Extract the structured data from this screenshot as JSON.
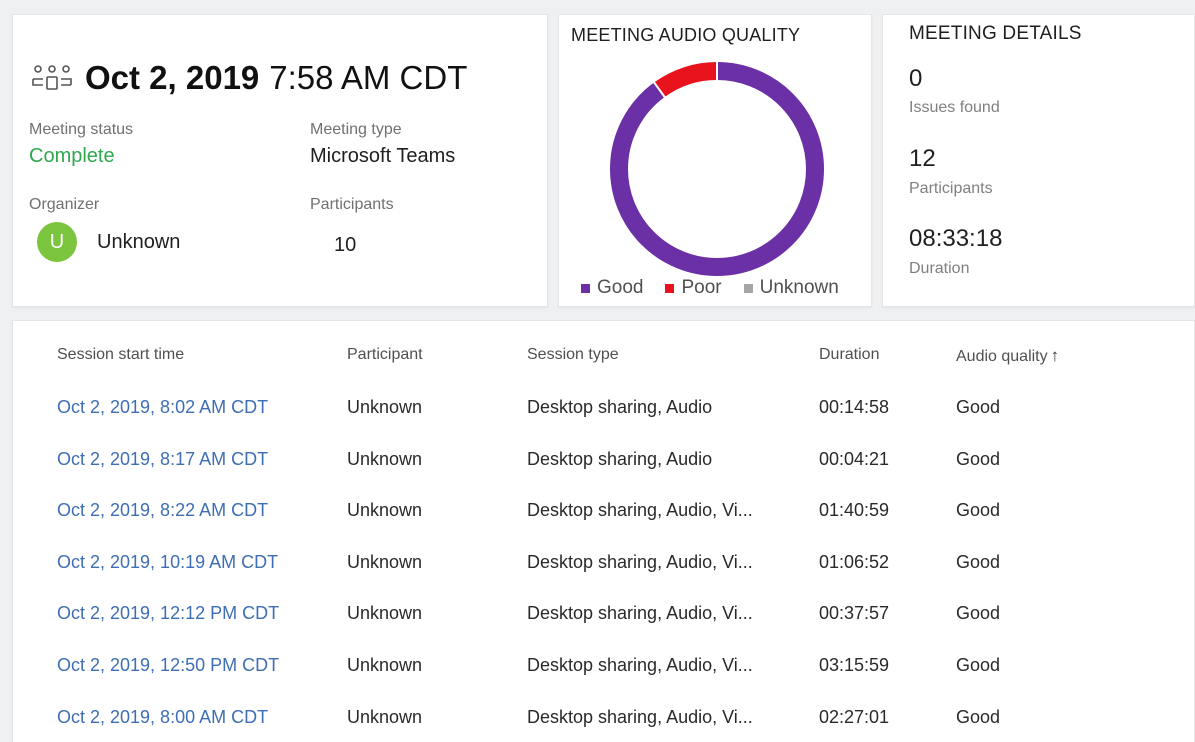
{
  "summary": {
    "date": "Oct 2, 2019",
    "time": "7:58 AM CDT",
    "meeting_status_label": "Meeting status",
    "meeting_status_value": "Complete",
    "meeting_type_label": "Meeting type",
    "meeting_type_value": "Microsoft Teams",
    "organizer_label": "Organizer",
    "organizer_initial": "U",
    "organizer_name": "Unknown",
    "participants_label": "Participants",
    "participants_value": "10"
  },
  "audio_quality": {
    "title": "MEETING AUDIO QUALITY",
    "legend": [
      {
        "label": "Good",
        "color": "#6b2fa6"
      },
      {
        "label": "Poor",
        "color": "#e8131d"
      },
      {
        "label": "Unknown",
        "color": "#a6a6a6"
      }
    ],
    "chart_data": {
      "type": "pie",
      "donut": true,
      "categories": [
        "Good",
        "Poor",
        "Unknown"
      ],
      "values": [
        90,
        10,
        0
      ],
      "colors": [
        "#6b2fa6",
        "#e8131d",
        "#a6a6a6"
      ],
      "legend_position": "bottom"
    }
  },
  "details": {
    "title": "MEETING DETAILS",
    "issues_value": "0",
    "issues_label": "Issues found",
    "participants_value": "12",
    "participants_label": "Participants",
    "duration_value": "08:33:18",
    "duration_label": "Duration"
  },
  "sessions": {
    "columns": [
      "Session start time",
      "Participant",
      "Session type",
      "Duration",
      "Audio quality"
    ],
    "sort_arrow": "↑",
    "rows": [
      [
        "Oct 2, 2019, 8:02 AM CDT",
        "Unknown",
        "Desktop sharing, Audio",
        "00:14:58",
        "Good"
      ],
      [
        "Oct 2, 2019, 8:17 AM CDT",
        "Unknown",
        "Desktop sharing, Audio",
        "00:04:21",
        "Good"
      ],
      [
        "Oct 2, 2019, 8:22 AM CDT",
        "Unknown",
        "Desktop sharing, Audio, Vi...",
        "01:40:59",
        "Good"
      ],
      [
        "Oct 2, 2019, 10:19 AM CDT",
        "Unknown",
        "Desktop sharing, Audio, Vi...",
        "01:06:52",
        "Good"
      ],
      [
        "Oct 2, 2019, 12:12 PM CDT",
        "Unknown",
        "Desktop sharing, Audio, Vi...",
        "00:37:57",
        "Good"
      ],
      [
        "Oct 2, 2019, 12:50 PM CDT",
        "Unknown",
        "Desktop sharing, Audio, Vi...",
        "03:15:59",
        "Good"
      ],
      [
        "Oct 2, 2019, 8:00 AM CDT",
        "Unknown",
        "Desktop sharing, Audio, Vi...",
        "02:27:01",
        "Good"
      ]
    ]
  }
}
